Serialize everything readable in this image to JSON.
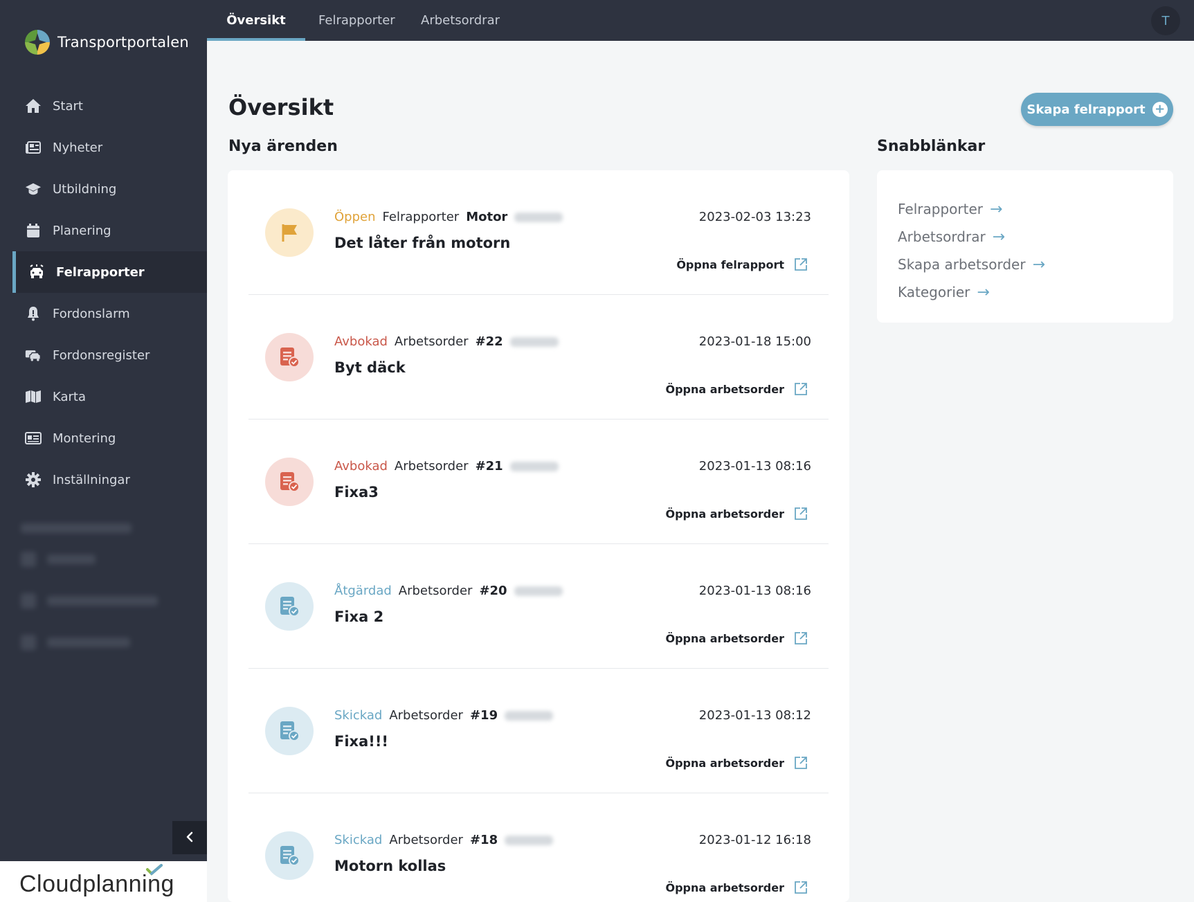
{
  "app": {
    "name": "Transportportalen",
    "footer_brand": "Cloudplanning"
  },
  "sidebar": {
    "items": [
      {
        "label": "Start",
        "icon": "home-icon"
      },
      {
        "label": "Nyheter",
        "icon": "newspaper-icon"
      },
      {
        "label": "Utbildning",
        "icon": "graduation-cap-icon"
      },
      {
        "label": "Planering",
        "icon": "calendar-icon"
      },
      {
        "label": "Felrapporter",
        "icon": "car-crash-icon",
        "active": true
      },
      {
        "label": "Fordonslarm",
        "icon": "bell-alarm-icon"
      },
      {
        "label": "Fordonsregister",
        "icon": "vehicle-register-icon"
      },
      {
        "label": "Karta",
        "icon": "map-icon"
      },
      {
        "label": "Montering",
        "icon": "id-card-icon"
      },
      {
        "label": "Inställningar",
        "icon": "gear-icon"
      }
    ],
    "collapse_icon": "chevron-left-icon"
  },
  "topbar": {
    "tabs": [
      {
        "label": "Översikt",
        "active": true
      },
      {
        "label": "Felrapporter"
      },
      {
        "label": "Arbetsordrar"
      }
    ],
    "avatar_initial": "T"
  },
  "main": {
    "title": "Översikt",
    "create_button": "Skapa felrapport",
    "new_cases_title": "Nya ärenden",
    "quick_links_title": "Snabblänkar"
  },
  "cases": [
    {
      "status": "Öppen",
      "status_color": "#e0a33a",
      "type": "Felrapporter",
      "ref": "Motor",
      "title": "Det låter från motorn",
      "date": "2023-02-03 13:23",
      "link": "Öppna felrapport",
      "icon": "flag-icon",
      "icon_bg": "#fbeacb",
      "icon_color": "#e0a33a"
    },
    {
      "status": "Avbokad",
      "status_color": "#c9584a",
      "type": "Arbetsorder",
      "ref": "#22",
      "title": "Byt däck",
      "date": "2023-01-18 15:00",
      "link": "Öppna arbetsorder",
      "icon": "work-order-icon",
      "icon_bg": "#f7dcd8",
      "icon_color": "#d9634f"
    },
    {
      "status": "Avbokad",
      "status_color": "#c9584a",
      "type": "Arbetsorder",
      "ref": "#21",
      "title": "Fixa3",
      "date": "2023-01-13 08:16",
      "link": "Öppna arbetsorder",
      "icon": "work-order-icon",
      "icon_bg": "#f7dcd8",
      "icon_color": "#d9634f"
    },
    {
      "status": "Åtgärdad",
      "status_color": "#6aa7c4",
      "type": "Arbetsorder",
      "ref": "#20",
      "title": "Fixa 2",
      "date": "2023-01-13 08:16",
      "link": "Öppna arbetsorder",
      "icon": "work-order-icon",
      "icon_bg": "#dcebf2",
      "icon_color": "#6aa7c4"
    },
    {
      "status": "Skickad",
      "status_color": "#6aa7c4",
      "type": "Arbetsorder",
      "ref": "#19",
      "title": "Fixa!!!",
      "date": "2023-01-13 08:12",
      "link": "Öppna arbetsorder",
      "icon": "work-order-icon",
      "icon_bg": "#dcebf2",
      "icon_color": "#6aa7c4"
    },
    {
      "status": "Skickad",
      "status_color": "#6aa7c4",
      "type": "Arbetsorder",
      "ref": "#18",
      "title": "Motorn kollas",
      "date": "2023-01-12 16:18",
      "link": "Öppna arbetsorder",
      "icon": "work-order-icon",
      "icon_bg": "#dcebf2",
      "icon_color": "#6aa7c4"
    }
  ],
  "quick_links": [
    {
      "label": "Felrapporter"
    },
    {
      "label": "Arbetsordrar"
    },
    {
      "label": "Skapa arbetsorder"
    },
    {
      "label": "Kategorier"
    }
  ],
  "colors": {
    "accent": "#6aa7c4",
    "sidebar_bg": "#2e3340"
  }
}
